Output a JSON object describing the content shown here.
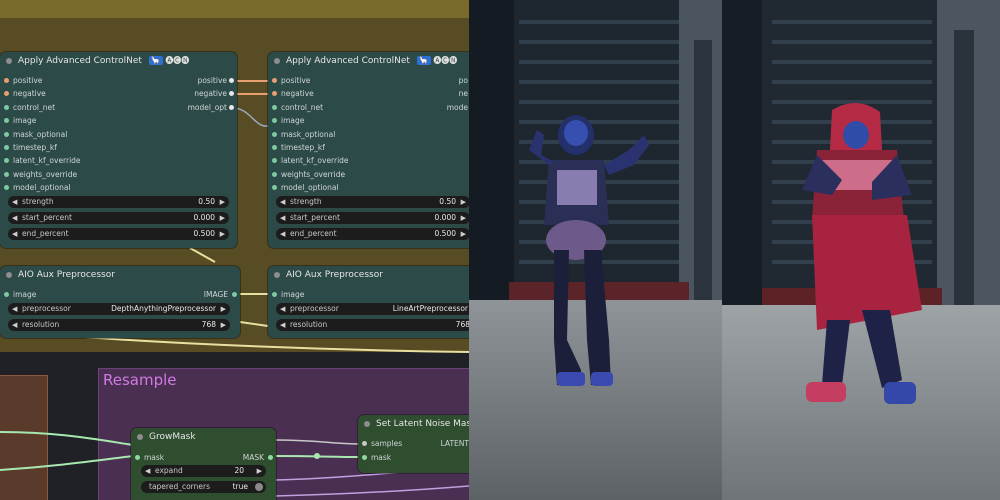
{
  "cn_node_1": {
    "title": "Apply Advanced ControlNet",
    "badge1": "🦙",
    "badge2": "🅐🅒🅝",
    "inputs": [
      "positive",
      "negative",
      "control_net",
      "image",
      "mask_optional",
      "timestep_kf",
      "latent_kf_override",
      "weights_override",
      "model_optional"
    ],
    "outputs": [
      "positive",
      "negative",
      "model_opt"
    ],
    "widgets": [
      {
        "label": "strength",
        "value": "0.50"
      },
      {
        "label": "start_percent",
        "value": "0.000"
      },
      {
        "label": "end_percent",
        "value": "0.500"
      }
    ]
  },
  "cn_node_2": {
    "title": "Apply Advanced ControlNet",
    "badge1": "🦙",
    "badge2": "🅐🅒🅝",
    "inputs": [
      "positive",
      "negative",
      "control_net",
      "image",
      "mask_optional",
      "timestep_kf",
      "latent_kf_override",
      "weights_override",
      "model_optional"
    ],
    "outputs": [
      "po",
      "ne",
      "mode"
    ],
    "widgets": [
      {
        "label": "strength",
        "value": "0.50"
      },
      {
        "label": "start_percent",
        "value": "0.000"
      },
      {
        "label": "end_percent",
        "value": "0.500"
      }
    ]
  },
  "aio_node_1": {
    "title": "AIO Aux Preprocessor",
    "input": "image",
    "output": "IMAGE",
    "preprocessor_label": "preprocessor",
    "preprocessor_value": "DepthAnythingPreprocessor",
    "resolution_label": "resolution",
    "resolution_value": "768"
  },
  "aio_node_2": {
    "title": "AIO Aux Preprocessor",
    "input": "image",
    "preprocessor_label": "preprocessor",
    "preprocessor_value": "LineArtPreprocessor",
    "resolution_label": "resolution",
    "resolution_value": "768"
  },
  "group_resample": {
    "title": "Resample"
  },
  "growmask": {
    "title": "GrowMask",
    "input": "mask",
    "output": "MASK",
    "expand_label": "expand",
    "expand_value": "20",
    "tapered_label": "tapered_corners",
    "tapered_value": "true"
  },
  "latent_mask": {
    "title": "Set Latent Noise Mask",
    "inputs": [
      "samples",
      "mask"
    ],
    "output": "LATENT"
  },
  "colors": {
    "node_bg": "#2c4a48",
    "group_yellow": "#574c23",
    "group_purple": "#4a2f52",
    "link_green": "#a8e8b0",
    "link_yellow": "#e8e0a0"
  }
}
